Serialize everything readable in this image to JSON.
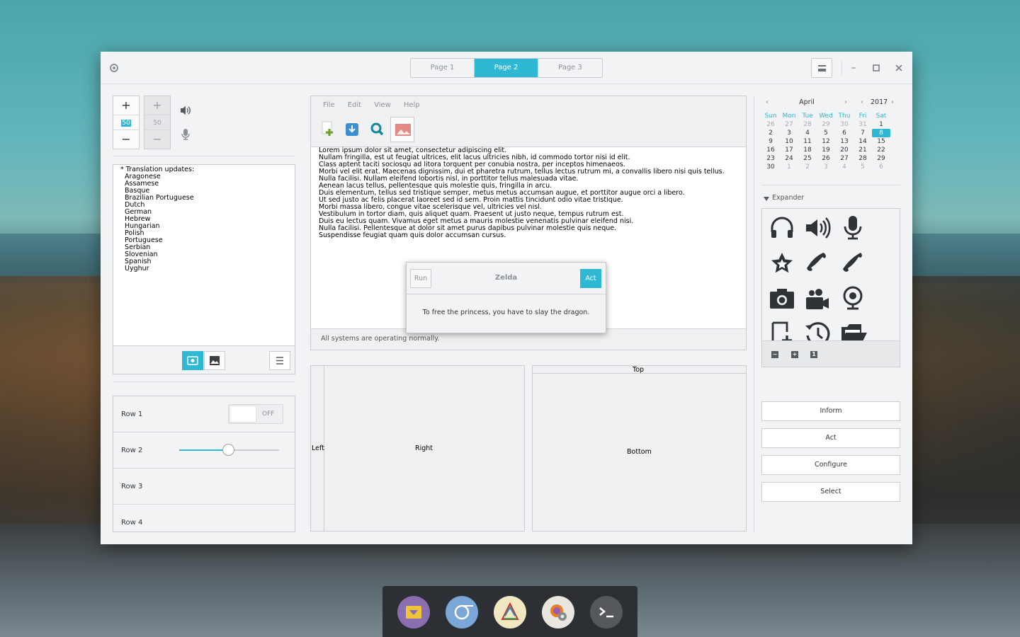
{
  "window": {
    "tabs": [
      {
        "label": "Page 1",
        "active": false
      },
      {
        "label": "Page 2",
        "active": true
      },
      {
        "label": "Page 3",
        "active": false
      }
    ]
  },
  "spinners": [
    {
      "plus": "+",
      "value": "50",
      "minus": "−",
      "enabled": true
    },
    {
      "plus": "+",
      "value": "50",
      "minus": "−",
      "enabled": false
    }
  ],
  "translation_list": {
    "lines": [
      "* Translation updates:",
      "  Aragonese",
      "  Assamese",
      "  Basque",
      "  Brazilian Portuguese",
      "  Dutch",
      "  German",
      "  Hebrew",
      "  Hungarian",
      "  Polish",
      "  Portuguese",
      "  Serbian",
      "  Slovenian",
      "  Spanish",
      "  Uyghur"
    ]
  },
  "list_rows": [
    {
      "label": "Row 1",
      "switch_text": "OFF"
    },
    {
      "label": "Row 2",
      "slider_fraction": 0.49
    },
    {
      "label": "Row 3"
    },
    {
      "label": "Row 4"
    }
  ],
  "editor": {
    "menu": [
      "File",
      "Edit",
      "View",
      "Help"
    ],
    "text_lines": [
      "Lorem ipsum dolor sit amet, consectetur adipiscing elit.",
      "Nullam fringilla, est ut feugiat ultrices, elit lacus ultricies nibh, id commodo tortor nisi id elit.",
      "Class aptent taciti sociosqu ad litora torquent per conubia nostra, per inceptos himenaeos.",
      "Morbi vel elit erat. Maecenas dignissim, dui et pharetra rutrum, tellus lectus rutrum mi, a convallis libero nisi quis tellus.",
      "Nulla facilisi. Nullam eleifend lobortis nisl, in porttitor tellus malesuada vitae.",
      "Aenean lacus tellus, pellentesque quis molestie quis, fringilla in arcu.",
      "Duis elementum, tellus sed tristique semper, metus metus accumsan augue, et porttitor augue orci a libero.",
      "Ut sed justo ac felis placerat laoreet sed id sem. Proin mattis tincidunt odio vitae tristique.",
      "Morbi massa libero, congue vitae scelerisque vel, ultricies vel nisl.",
      "Vestibulum in tortor diam, quis aliquet quam. Praesent ut justo neque, tempus rutrum est.",
      "Duis eu lectus quam. Vivamus eget metus a mauris molestie venenatis pulvinar eleifend nisi.",
      "Nulla facilisi. Pellentesque at dolor sit amet purus dapibus pulvinar molestie quis neque.",
      "Suspendisse feugiat quam quis dolor accumsan cursus."
    ],
    "status": "All systems are operating normally."
  },
  "popover": {
    "run_label": "Run",
    "title": "Zelda",
    "act_label": "Act",
    "message": "To free the princess, you have to slay the dragon."
  },
  "paned": {
    "left": "Left",
    "right": "Right",
    "top": "Top",
    "bottom": "Bottom"
  },
  "calendar": {
    "month": "April",
    "year": "2017",
    "weekdays": [
      "Sun",
      "Mon",
      "Tue",
      "Wed",
      "Thu",
      "Fri",
      "Sat"
    ],
    "weeks": [
      [
        "26",
        "27",
        "28",
        "29",
        "30",
        "31",
        "1"
      ],
      [
        "2",
        "3",
        "4",
        "5",
        "6",
        "7",
        "8"
      ],
      [
        "9",
        "10",
        "11",
        "12",
        "13",
        "14",
        "15"
      ],
      [
        "16",
        "17",
        "18",
        "19",
        "20",
        "21",
        "22"
      ],
      [
        "23",
        "24",
        "25",
        "26",
        "27",
        "28",
        "29"
      ],
      [
        "30",
        "1",
        "2",
        "3",
        "4",
        "5",
        "6"
      ]
    ],
    "selected_day": "8"
  },
  "expander": {
    "label": "Expander",
    "icons": [
      "headphones-icon",
      "speaker-icon",
      "microphone-icon",
      "star-icon",
      "phone-icon",
      "phone-alt-icon",
      "camera-icon",
      "video-camera-icon",
      "webcam-icon",
      "new-document-icon",
      "history-icon",
      "open-folder-icon"
    ]
  },
  "buttons": [
    "Inform",
    "Act",
    "Configure",
    "Select"
  ],
  "colors": {
    "accent": "#2eb8d3"
  }
}
